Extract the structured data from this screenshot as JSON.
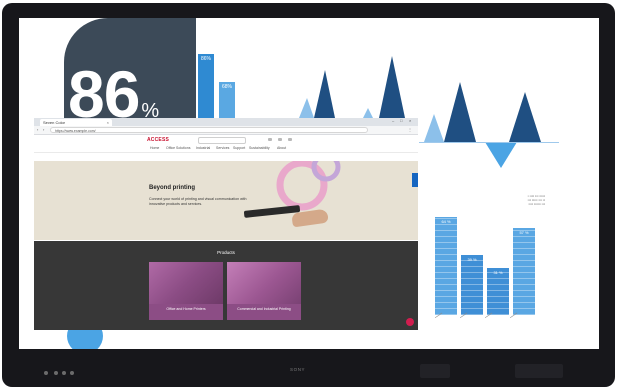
{
  "infographic": {
    "big_stat": "86",
    "big_stat_unit": "%",
    "small_bar_labels": [
      "86%",
      "68%"
    ],
    "right_bar_labels": [
      "64 %",
      "39 %",
      "31 %",
      "57 %"
    ],
    "right_bar_values": [
      64,
      39,
      31,
      57
    ],
    "colors": {
      "dark_card": "#3c4a58",
      "accent_blue": "#2f8ad2",
      "light_blue": "#8cc0ea",
      "navy": "#1f4f82"
    }
  },
  "browser": {
    "tab_title": "Seven Color",
    "url": "https://www.example.com/",
    "site_logo": "ACCESS",
    "nav_items": [
      "Home",
      "Office Solutions",
      "Industrial",
      "Services",
      "Support",
      "Sustainability",
      "About"
    ],
    "hero": {
      "title": "Beyond printing",
      "subtitle": "Connect your world of printing and visual communication with innovative products and services."
    },
    "products": {
      "heading": "Products",
      "cards": [
        {
          "label": "Office and Home Printers"
        },
        {
          "label": "Commercial and Industrial Printing"
        }
      ]
    }
  },
  "device": {
    "brand": "SONY"
  }
}
